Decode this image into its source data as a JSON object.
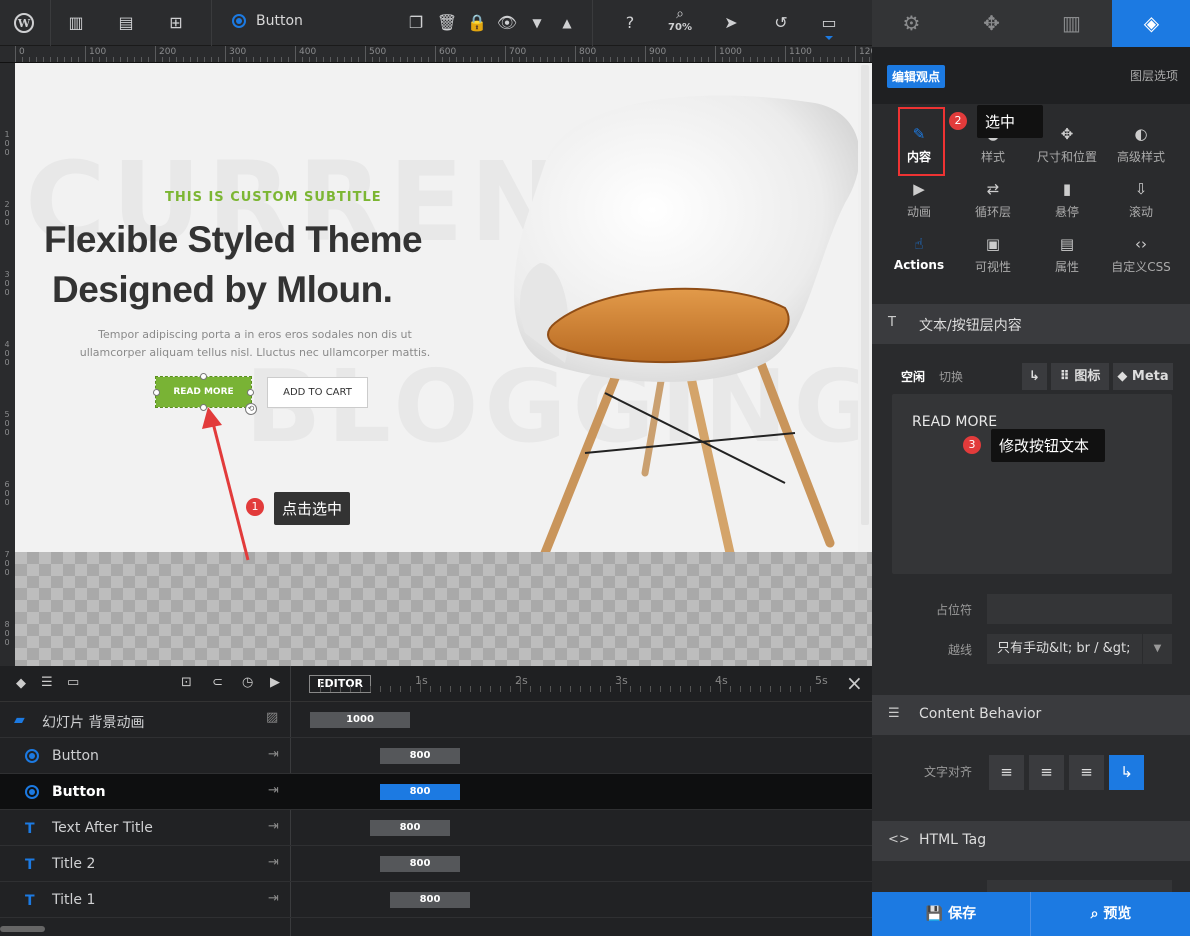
{
  "toolbar": {
    "layer_name": "Button",
    "zoom": "70%"
  },
  "ruler": {
    "top_marks": [
      "0",
      "100",
      "200",
      "300",
      "400",
      "500",
      "600",
      "700",
      "800",
      "900",
      "1000",
      "1100",
      "120"
    ],
    "left_marks": [
      "1",
      "0",
      "0",
      "2",
      "0",
      "0",
      "3",
      "0",
      "0",
      "4",
      "0",
      "0",
      "5",
      "0",
      "0",
      "6",
      "0",
      "0",
      "7",
      "0",
      "0",
      "8",
      "0",
      "0"
    ]
  },
  "canvas": {
    "bg_word_1": "CURREN",
    "bg_word_2": "BLOGGING",
    "subtitle": "THIS IS CUSTOM SUBTITLE",
    "title_line1": "Flexible Styled Theme",
    "title_line2": "Designed by Mloun.",
    "description": "Tempor adipiscing porta a in eros eros sodales non dis ut ullamcorper aliquam tellus nisl. Lluctus nec ullamcorper mattis.",
    "read_more_label": "READ MORE",
    "add_to_cart_label": "ADD TO CART"
  },
  "annotations": {
    "step1_num": "1",
    "step1_text": "点击选中",
    "step2_num": "2",
    "step2_text": "选中",
    "step3_num": "3",
    "step3_text": "修改按钮文本"
  },
  "timeline": {
    "editor_label": "EDITOR",
    "time_marks": [
      "1s",
      "2s",
      "3s",
      "4s",
      "5s"
    ],
    "rows": [
      {
        "label": "幻灯片 背景动画",
        "value": "1000"
      },
      {
        "label": "Button",
        "value": "800"
      },
      {
        "label": "Button",
        "value": "800"
      },
      {
        "label": "Text After Title",
        "value": "800"
      },
      {
        "label": "Title 2",
        "value": "800"
      },
      {
        "label": "Title 1",
        "value": "800"
      }
    ]
  },
  "panel": {
    "edit_viewpoint": "编辑观点",
    "layer_options": "图层选项",
    "modules": [
      {
        "label": "内容",
        "icon": "pencil-icon"
      },
      {
        "label": "样式",
        "icon": "palette-icon"
      },
      {
        "label": "尺寸和位置",
        "icon": "move-icon"
      },
      {
        "label": "高级样式",
        "icon": "contrast-icon"
      },
      {
        "label": "动画",
        "icon": "play-icon"
      },
      {
        "label": "循环层",
        "icon": "loop-icon"
      },
      {
        "label": "悬停",
        "icon": "mouse-icon"
      },
      {
        "label": "滚动",
        "icon": "scroll-icon"
      },
      {
        "label": "Actions",
        "icon": "hand-icon"
      },
      {
        "label": "可视性",
        "icon": "visibility-icon"
      },
      {
        "label": "属性",
        "icon": "document-icon"
      },
      {
        "label": "自定义CSS",
        "icon": "code-icon"
      }
    ],
    "section_text": "文本/按钮层内容",
    "tab_idle": "空闲",
    "tab_toggle": "切换",
    "chip_icon": "图标",
    "chip_meta": "Meta",
    "text_value": "READ MORE",
    "placeholder_label": "占位符",
    "placeholder_value": "",
    "linebreak_label": "越线",
    "linebreak_value": "只有手动&lt; br / &gt;",
    "section_behavior": "Content Behavior",
    "text_align_label": "文字对齐",
    "section_html": "HTML Tag",
    "save_label": "保存",
    "preview_label": "预览"
  },
  "colors": {
    "accent": "#1c7ae2",
    "brand_green": "#7cb633",
    "annotation_red": "#e23b3b"
  }
}
